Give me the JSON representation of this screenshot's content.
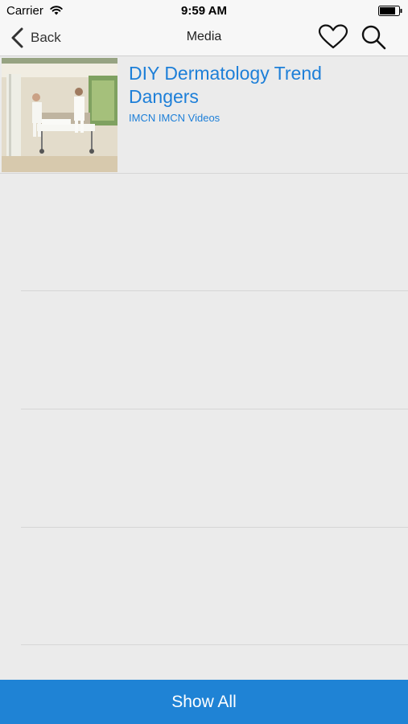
{
  "status_bar": {
    "carrier": "Carrier",
    "time": "9:59 AM",
    "wifi_icon": "wifi-icon",
    "battery_icon": "battery-icon"
  },
  "nav": {
    "back_label": "Back",
    "title": "Media",
    "favorite_icon": "heart-icon",
    "search_icon": "search-icon"
  },
  "media_items": [
    {
      "title": "DIY Dermatology Trend Dangers",
      "tags": "IMCN IMCN Videos",
      "thumbnail": "hospital-room-photo"
    }
  ],
  "footer": {
    "show_all_label": "Show All"
  },
  "colors": {
    "accent": "#1d7fd8",
    "button_bg": "#1f83d5",
    "list_bg": "#ebebeb",
    "bar_bg": "#f7f7f7"
  }
}
